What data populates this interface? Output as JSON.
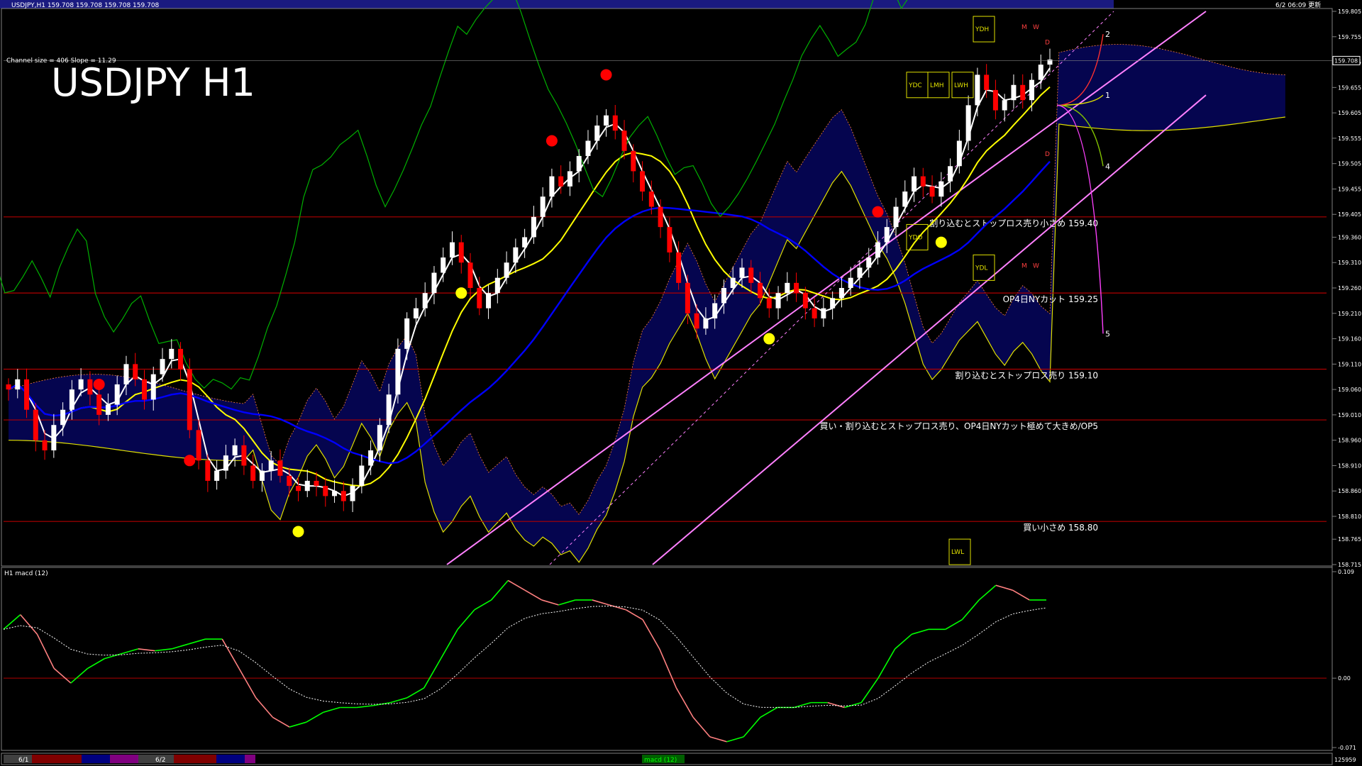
{
  "header": {
    "symbol_line": "USDJPY,H1  159.708 159.708 159.708 159.708",
    "channel_info": "Channel size = 406 Slope = 11.29",
    "server_time": "6/2 06:09 更新",
    "big_title": "USDJPY H1"
  },
  "colors": {
    "background": "#000000",
    "bull_candle": "#ffffff",
    "bear_candle": "#ff0000",
    "ma_fast": "#ffffff",
    "ma_mid": "#ffff00",
    "ma_slow": "#0000ff",
    "chikou": "#00b000",
    "level_line": "#b00000",
    "channel_line": "#ff80ff",
    "kumo_up": "#0000ff",
    "kumo_down": "#ff8040",
    "macd_up": "#00ff00",
    "macd_down": "#ff8080"
  },
  "chart_data": [
    {
      "type": "candlestick",
      "title": "USDJPY H1",
      "ylim": [
        158.715,
        159.805
      ],
      "y_ticks": [
        "159.805",
        "159.755",
        "159.705",
        "159.655",
        "159.605",
        "159.555",
        "159.505",
        "159.455",
        "159.405",
        "159.360",
        "159.310",
        "159.260",
        "159.210",
        "159.160",
        "159.110",
        "159.060",
        "159.010",
        "158.960",
        "158.910",
        "158.860",
        "158.810",
        "158.765",
        "158.715"
      ],
      "current_price": "159.708",
      "closes": [
        159.06,
        159.08,
        159.02,
        158.96,
        158.94,
        158.99,
        159.02,
        159.06,
        159.08,
        159.05,
        159.01,
        159.03,
        159.07,
        159.11,
        159.08,
        159.04,
        159.09,
        159.12,
        159.14,
        159.1,
        158.98,
        158.92,
        158.88,
        158.9,
        158.93,
        158.95,
        158.91,
        158.88,
        158.9,
        158.92,
        158.89,
        158.87,
        158.86,
        158.88,
        158.87,
        158.85,
        158.86,
        158.84,
        158.87,
        158.91,
        158.94,
        158.99,
        159.05,
        159.14,
        159.2,
        159.22,
        159.25,
        159.29,
        159.32,
        159.35,
        159.31,
        159.26,
        159.22,
        159.25,
        159.28,
        159.31,
        159.34,
        159.36,
        159.4,
        159.44,
        159.48,
        159.46,
        159.49,
        159.52,
        159.55,
        159.58,
        159.6,
        159.57,
        159.53,
        159.49,
        159.45,
        159.42,
        159.38,
        159.33,
        159.27,
        159.21,
        159.18,
        159.2,
        159.23,
        159.26,
        159.28,
        159.3,
        159.27,
        159.24,
        159.22,
        159.25,
        159.27,
        159.25,
        159.22,
        159.2,
        159.22,
        159.24,
        159.26,
        159.28,
        159.3,
        159.32,
        159.35,
        159.38,
        159.42,
        159.45,
        159.48,
        159.46,
        159.44,
        159.47,
        159.5,
        159.55,
        159.62,
        159.68,
        159.65,
        159.61,
        159.63,
        159.66,
        159.63,
        159.67,
        159.7,
        159.71
      ],
      "levels": [
        {
          "price": 159.4,
          "label": "割り込むとストップロス売り小さめ 159.40"
        },
        {
          "price": 159.25,
          "label": "OP4日NYカット 159.25"
        },
        {
          "price": 159.1,
          "label": "割り込むとストップロス売り 159.10"
        },
        {
          "price": 159.0,
          "label": "買い・割り込むとストップロス売り、OP4日NYカット極めて大きめ/OP5"
        },
        {
          "price": 158.8,
          "label": "買い小さめ 158.80"
        }
      ],
      "period_boxes": [
        "YDC",
        "YDH",
        "YDL",
        "YDO",
        "LMH",
        "LWH",
        "LWL",
        "M",
        "W",
        "D"
      ],
      "projection_labels": [
        "1",
        "2",
        "4",
        "5"
      ]
    },
    {
      "type": "line",
      "title": "H1 macd (12)",
      "ylim": [
        -0.071,
        0.109
      ],
      "y_ticks": [
        "0.109",
        "0.00",
        "-0.071"
      ],
      "series": [
        {
          "name": "",
          "values": [
            0.05,
            0.065,
            0.045,
            0.01,
            -0.005,
            0.01,
            0.02,
            0.025,
            0.03,
            0.028,
            0.03,
            0.035,
            0.04,
            0.04,
            0.01,
            -0.02,
            -0.04,
            -0.05,
            -0.045,
            -0.035,
            -0.03,
            -0.03,
            -0.028,
            -0.025,
            -0.02,
            -0.01,
            0.02,
            0.05,
            0.07,
            0.08,
            0.1,
            0.09,
            0.08,
            0.075,
            0.08,
            0.08,
            0.075,
            0.07,
            0.06,
            0.03,
            -0.01,
            -0.04,
            -0.06,
            -0.065,
            -0.06,
            -0.04,
            -0.03,
            -0.03,
            -0.025,
            -0.025,
            -0.03,
            -0.025,
            0.0,
            0.03,
            0.045,
            0.05,
            0.05,
            0.06,
            0.08,
            0.095,
            0.09,
            0.08,
            0.08
          ]
        }
      ]
    }
  ],
  "bottom_bar": {
    "date_1": "6/1",
    "date_2": "6/2",
    "tab_label": "macd (12)",
    "right_label": "125959"
  }
}
